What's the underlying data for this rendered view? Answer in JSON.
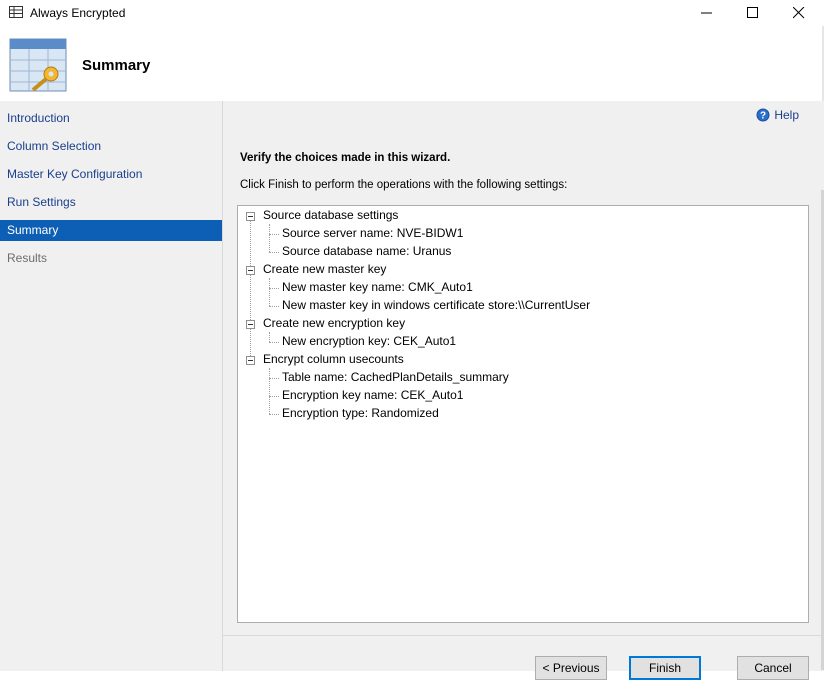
{
  "window": {
    "title": "Always Encrypted",
    "controls": [
      "minimize-icon",
      "maximize-icon",
      "close-icon"
    ]
  },
  "header": {
    "page_title": "Summary"
  },
  "sidebar": {
    "items": [
      {
        "label": "Introduction",
        "state": "normal"
      },
      {
        "label": "Column Selection",
        "state": "normal"
      },
      {
        "label": "Master Key Configuration",
        "state": "normal"
      },
      {
        "label": "Run Settings",
        "state": "normal"
      },
      {
        "label": "Summary",
        "state": "active"
      },
      {
        "label": "Results",
        "state": "disabled"
      }
    ]
  },
  "main": {
    "help_label": "Help",
    "verify_heading": "Verify the choices made in this wizard.",
    "instructions": "Click Finish to perform the operations with the following settings:",
    "tree": [
      {
        "label": "Source database settings",
        "children": [
          "Source server name: NVE-BIDW1",
          "Source database name: Uranus"
        ]
      },
      {
        "label": "Create new master key",
        "children": [
          "New master key name: CMK_Auto1",
          "New master key in windows certificate store:\\\\CurrentUser"
        ]
      },
      {
        "label": "Create new encryption key",
        "children": [
          "New encryption key: CEK_Auto1"
        ]
      },
      {
        "label": "Encrypt column usecounts",
        "children": [
          "Table name: CachedPlanDetails_summary",
          "Encryption key name: CEK_Auto1",
          "Encryption type: Randomized"
        ]
      }
    ]
  },
  "footer": {
    "previous_label": "< Previous",
    "finish_label": "Finish",
    "cancel_label": "Cancel"
  },
  "colors": {
    "accent": "#0c5fb5",
    "link": "#1a3e8c",
    "panel": "#f0f0f0"
  }
}
